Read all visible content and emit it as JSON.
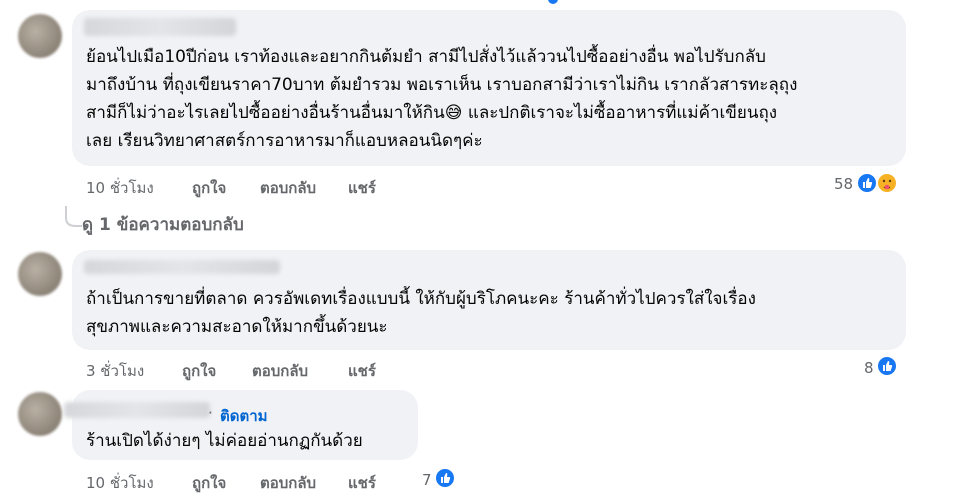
{
  "comments": [
    {
      "lines": [
        "ย้อนไปเมือ10ปีก่อน เราท้องและอยากกินต้มยำ สามีไปสั่งไว้แล้ววนไปซื้ออย่างอื่น พอไปรับกลับ",
        "มาถึงบ้าน ที่ถุงเขียนราคา70บาท ต้มยำรวม พอเราเห็น เราบอกสามีว่าเราไม่กิน เรากลัวสารทะลุถุง",
        "สามีก็ไม่ว่าอะไรเลยไปซื้ออย่างอื่นร้านอื่นมาให้กิน",
        "เลย เรียนวิทยาศาสตร์การอาหารมาก็แอบหลอนนิดๆค่ะ"
      ],
      "line3_tail": " และปกติเราจะไม่ซื้ออาหารที่แม่ค้าเขียนถุง",
      "emoji": "😅",
      "time": "10 ชั่วโมง",
      "like": "ถูกใจ",
      "reply": "ตอบกลับ",
      "share": "แชร์",
      "reactions": "58",
      "reaction_icons": [
        "thumbs-up-icon",
        "care-emoji-icon"
      ]
    },
    {
      "lines": [
        "ถ้าเป็นการขายที่ตลาด ควรอัพเดทเรื่องแบบนี้ ให้กับผู้บริโภคนะคะ ร้านค้าทั่วไปควรใส่ใจเรื่อง",
        "สุขภาพและความสะอาดให้มากขึ้นด้วยนะ"
      ],
      "time": "3 ชั่วโมง",
      "like": "ถูกใจ",
      "reply": "ตอบกลับ",
      "share": "แชร์",
      "reactions": "8",
      "reaction_icons": [
        "thumbs-up-icon"
      ]
    },
    {
      "follow_dot": "·",
      "follow": "ติดตาม",
      "lines": [
        "ร้านเปิดได้ง่ายๆ ไม่ค่อยอ่านกฏกันด้วย"
      ],
      "time": "10 ชั่วโมง",
      "like": "ถูกใจ",
      "reply": "ตอบกลับ",
      "share": "แชร์",
      "reactions": "7",
      "reaction_icons": [
        "thumbs-up-icon"
      ]
    }
  ],
  "view_replies": "ดู 1 ข้อความตอบกลับ",
  "colors": {
    "bubble": "#f0f2f5",
    "link": "#0064d1",
    "meta": "#65676b",
    "like": "#1877f2"
  }
}
